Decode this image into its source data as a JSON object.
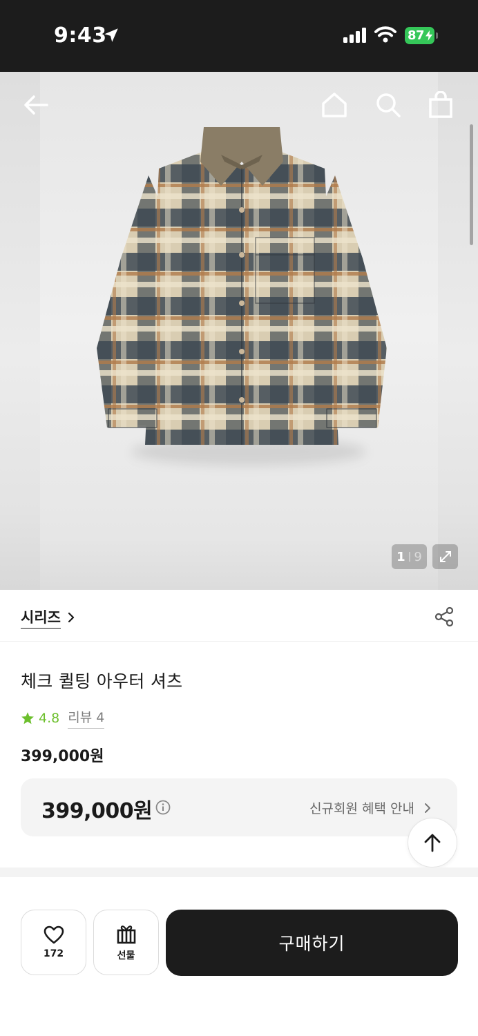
{
  "status_bar": {
    "time": "9:43",
    "battery": "87"
  },
  "gallery": {
    "current_index": "1",
    "separator": "|",
    "total": "9"
  },
  "brand": {
    "label": "시리즈"
  },
  "product": {
    "title": "체크 퀼팅 아우터 셔츠",
    "rating": "4.8",
    "review_label": "리뷰 4",
    "price": "399,000원"
  },
  "benefit": {
    "price": "399,000원",
    "link_label": "신규회원 혜택 안내"
  },
  "bottom_bar": {
    "like_count": "172",
    "gift_label": "선물",
    "buy_label": "구매하기"
  },
  "colors": {
    "accent_green": "#6cbf2c",
    "battery_green": "#35c759",
    "buy_button": "#1c1c1c"
  },
  "icons": [
    "location-arrow-icon",
    "signal-icon",
    "wifi-icon",
    "back-arrow-icon",
    "home-icon",
    "search-icon",
    "shopping-bag-icon",
    "expand-icon",
    "chevron-right-icon",
    "share-icon",
    "star-icon",
    "info-icon",
    "arrow-up-icon",
    "heart-icon",
    "gift-icon"
  ]
}
